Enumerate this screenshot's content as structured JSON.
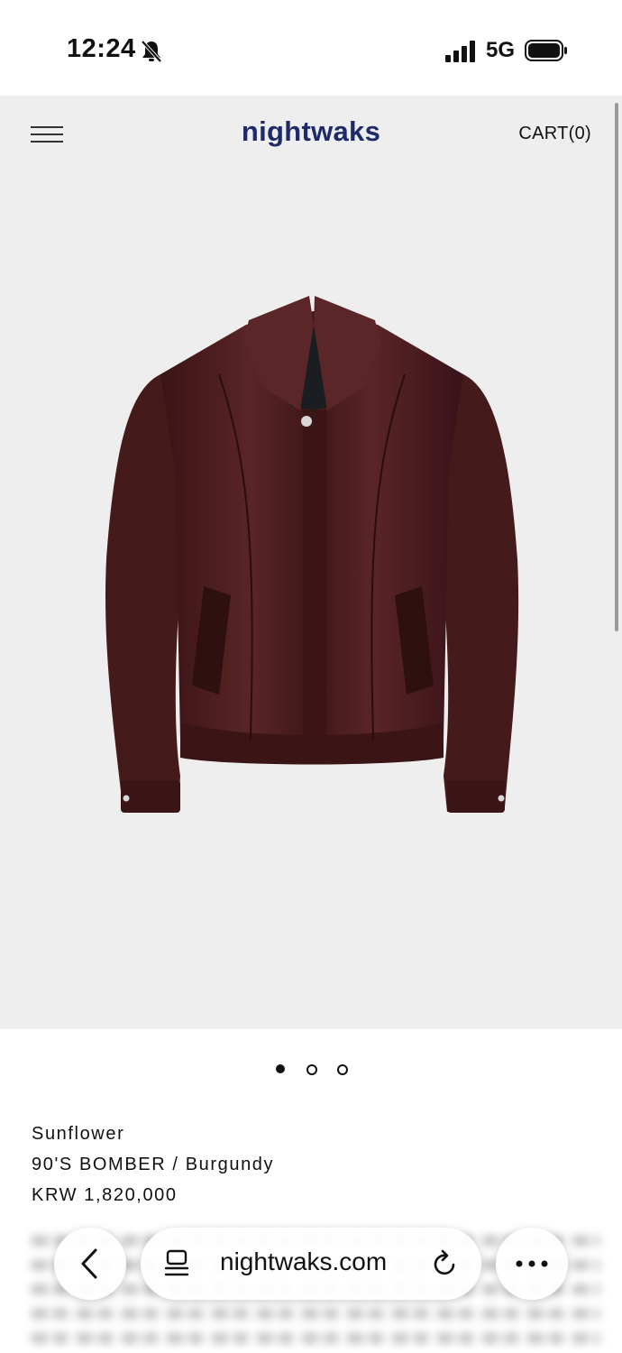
{
  "status_bar": {
    "time": "12:24",
    "network": "5G"
  },
  "header": {
    "brand": "nightwaks",
    "cart": "CART(0)"
  },
  "carousel": {
    "slides": 3,
    "active_index": 0
  },
  "product": {
    "brand": "Sunflower",
    "name": "90'S BOMBER / Burgundy",
    "price": "KRW 1,820,000"
  },
  "browser": {
    "url": "nightwaks.com"
  },
  "colors": {
    "brand": "#1f2a6b",
    "hero_bg": "#eeeeef",
    "jacket": "#4a1c1d"
  },
  "icons": [
    "bell-slash-icon",
    "signal-icon",
    "battery-icon",
    "menu-icon",
    "back-chevron-icon",
    "tabs-icon",
    "reload-icon",
    "more-icon"
  ]
}
